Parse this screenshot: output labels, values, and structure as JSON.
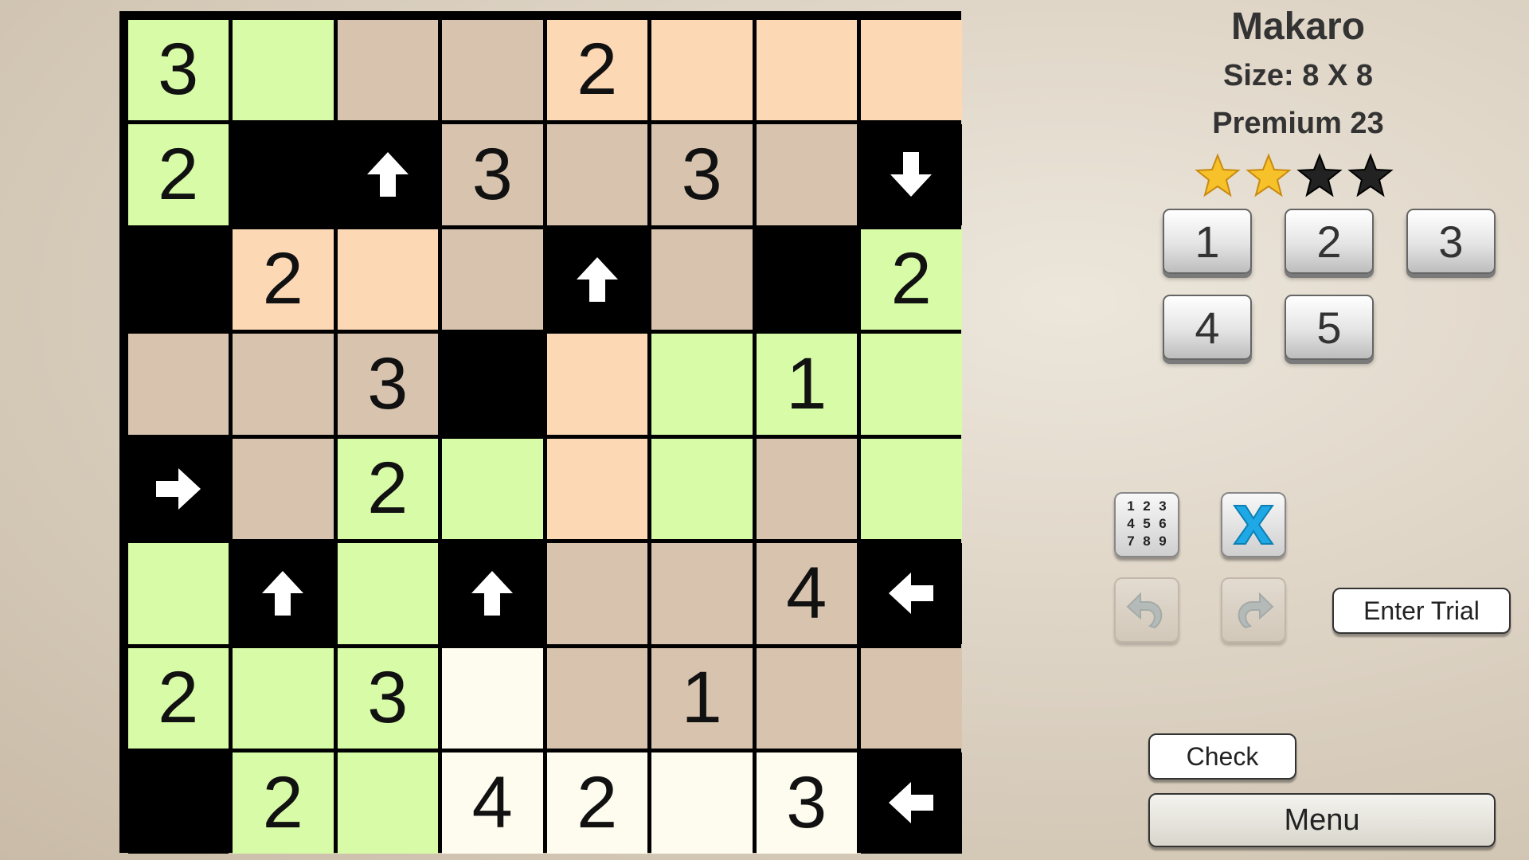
{
  "header": {
    "title": "Makaro",
    "size_label": "Size: 8 X 8",
    "level_label": "Premium 23"
  },
  "difficulty": {
    "stars_filled": 2,
    "stars_total": 4
  },
  "colors": {
    "black": "#000000",
    "green": "#d7fba6",
    "peach": "#fdd8b5",
    "tan": "#d8c4ae",
    "cream": "#fefcee",
    "star_gold": "#f7c12a",
    "star_dark": "#222222",
    "clear_blue": "#1ea9e6"
  },
  "board": {
    "rows": 8,
    "cols": 8,
    "cells": [
      [
        {
          "c": "green",
          "v": "3"
        },
        {
          "c": "green",
          "v": ""
        },
        {
          "c": "tan",
          "v": ""
        },
        {
          "c": "tan",
          "v": ""
        },
        {
          "c": "peach",
          "v": "2"
        },
        {
          "c": "peach",
          "v": ""
        },
        {
          "c": "peach",
          "v": ""
        },
        {
          "c": "peach",
          "v": ""
        }
      ],
      [
        {
          "c": "green",
          "v": "2"
        },
        {
          "c": "black",
          "v": ""
        },
        {
          "c": "black",
          "a": "up"
        },
        {
          "c": "tan",
          "v": "3"
        },
        {
          "c": "tan",
          "v": ""
        },
        {
          "c": "tan",
          "v": "3"
        },
        {
          "c": "tan",
          "v": ""
        },
        {
          "c": "black",
          "a": "down"
        }
      ],
      [
        {
          "c": "black",
          "v": ""
        },
        {
          "c": "peach",
          "v": "2"
        },
        {
          "c": "peach",
          "v": ""
        },
        {
          "c": "tan",
          "v": ""
        },
        {
          "c": "black",
          "a": "up"
        },
        {
          "c": "tan",
          "v": ""
        },
        {
          "c": "black",
          "v": ""
        },
        {
          "c": "green",
          "v": "2"
        }
      ],
      [
        {
          "c": "tan",
          "v": ""
        },
        {
          "c": "tan",
          "v": ""
        },
        {
          "c": "tan",
          "v": "3"
        },
        {
          "c": "black",
          "v": ""
        },
        {
          "c": "peach",
          "v": ""
        },
        {
          "c": "green",
          "v": ""
        },
        {
          "c": "green",
          "v": "1"
        },
        {
          "c": "green",
          "v": ""
        }
      ],
      [
        {
          "c": "black",
          "a": "right"
        },
        {
          "c": "tan",
          "v": ""
        },
        {
          "c": "green",
          "v": "2"
        },
        {
          "c": "green",
          "v": ""
        },
        {
          "c": "peach",
          "v": ""
        },
        {
          "c": "green",
          "v": ""
        },
        {
          "c": "tan",
          "v": ""
        },
        {
          "c": "green",
          "v": ""
        }
      ],
      [
        {
          "c": "green",
          "v": ""
        },
        {
          "c": "black",
          "a": "up"
        },
        {
          "c": "green",
          "v": ""
        },
        {
          "c": "black",
          "a": "up"
        },
        {
          "c": "tan",
          "v": ""
        },
        {
          "c": "tan",
          "v": ""
        },
        {
          "c": "tan",
          "v": "4"
        },
        {
          "c": "black",
          "a": "left"
        }
      ],
      [
        {
          "c": "green",
          "v": "2"
        },
        {
          "c": "green",
          "v": ""
        },
        {
          "c": "green",
          "v": "3"
        },
        {
          "c": "cream",
          "v": ""
        },
        {
          "c": "tan",
          "v": ""
        },
        {
          "c": "tan",
          "v": "1"
        },
        {
          "c": "tan",
          "v": ""
        },
        {
          "c": "tan",
          "v": ""
        }
      ],
      [
        {
          "c": "black",
          "v": ""
        },
        {
          "c": "green",
          "v": "2"
        },
        {
          "c": "green",
          "v": ""
        },
        {
          "c": "cream",
          "v": "4"
        },
        {
          "c": "cream",
          "v": "2"
        },
        {
          "c": "cream",
          "v": ""
        },
        {
          "c": "cream",
          "v": "3"
        },
        {
          "c": "black",
          "a": "left"
        }
      ]
    ]
  },
  "keypad": {
    "keys": [
      "1",
      "2",
      "3",
      "4",
      "5"
    ]
  },
  "tools": {
    "memo_digits": [
      "1",
      "2",
      "3",
      "4",
      "5",
      "6",
      "7",
      "8",
      "9"
    ],
    "memo_icon": "number-grid-icon",
    "clear_icon": "blue-x-icon",
    "undo_icon": "undo-arrow-icon",
    "redo_icon": "redo-arrow-icon"
  },
  "buttons": {
    "enter_trial": "Enter Trial",
    "check": "Check",
    "menu": "Menu"
  }
}
